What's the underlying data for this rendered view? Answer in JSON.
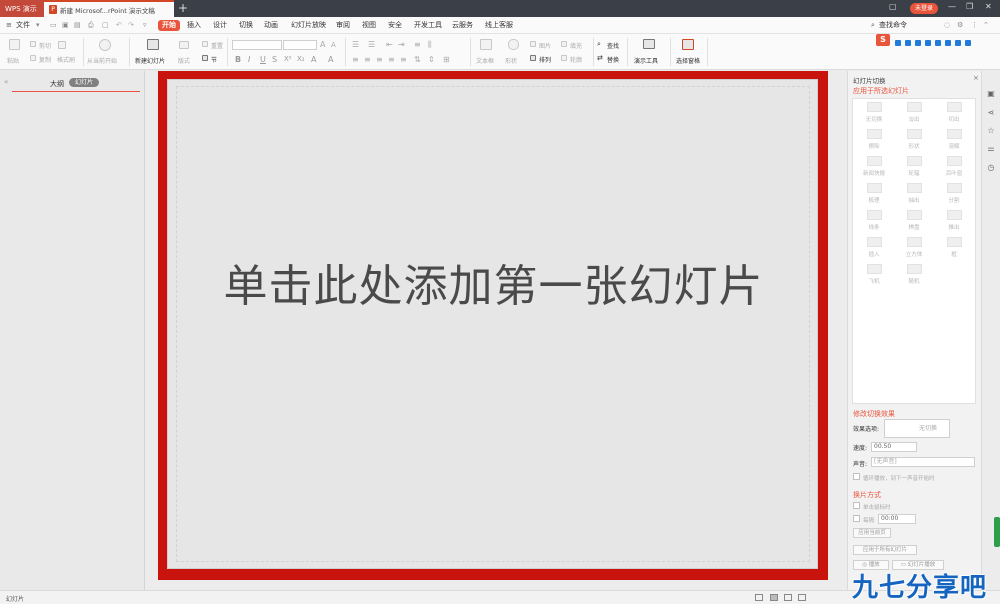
{
  "titlebar": {
    "app_tab": "WPS 演示",
    "doc_tab": "新建 Microsof...rPoint 演示文稿",
    "login": "未登录"
  },
  "menubar": {
    "file": "文件",
    "items": [
      "开始",
      "插入",
      "设计",
      "切换",
      "动画",
      "幻灯片放映",
      "审阅",
      "视图",
      "安全",
      "开发工具",
      "云服务",
      "线上客服"
    ],
    "search": "查找命令"
  },
  "ribbon": {
    "paste": "粘贴",
    "cut": "剪切",
    "copy": "复制",
    "format_painter": "格式刷",
    "play_from_current": "从当前开始",
    "new_slide": "新建幻灯片",
    "layout": "版式",
    "reset": "重置",
    "section": "节",
    "textbox": "文本框",
    "shape": "形状",
    "arrange": "排列",
    "image": "图片",
    "fill": "填充",
    "outline": "轮廓",
    "find": "查找",
    "replace": "替换",
    "presentation_tools": "演示工具",
    "select_pane": "选择窗格"
  },
  "leftpane": {
    "outline_tab": "大纲",
    "slides_tab": "幻灯片"
  },
  "slide": {
    "placeholder": "单击此处添加第一张幻灯片"
  },
  "rightpane": {
    "title": "幻灯片切换",
    "apply_selected": "应用于所选幻灯片",
    "transitions": [
      "无切换",
      "淡出",
      "切出",
      "擦除",
      "形状",
      "溶解",
      "新闻快报",
      "轮辐",
      "百叶窗",
      "梳理",
      "抽出",
      "分割",
      "线条",
      "棋盘",
      "推出",
      "插入",
      "立方体",
      "框",
      "飞机",
      "随机"
    ],
    "modify_title": "修改切换效果",
    "effect_label": "效果选项:",
    "effect_value": "无切换",
    "speed_label": "速度:",
    "speed_value": "00.50",
    "sound_label": "声音:",
    "sound_value": "[无声音]",
    "loop_label": "循环播放，到下一声音开始时",
    "advance_title": "换片方式",
    "on_click": "单击鼠标时",
    "every_label": "每隔",
    "every_value": "00:00",
    "apply_current": "应用当前页",
    "apply_all": "应用于所有幻灯片",
    "play": "播放",
    "slideshow": "幻灯片播放"
  },
  "statusbar": {
    "mode": "幻灯片"
  },
  "watermark": "九七分享吧"
}
